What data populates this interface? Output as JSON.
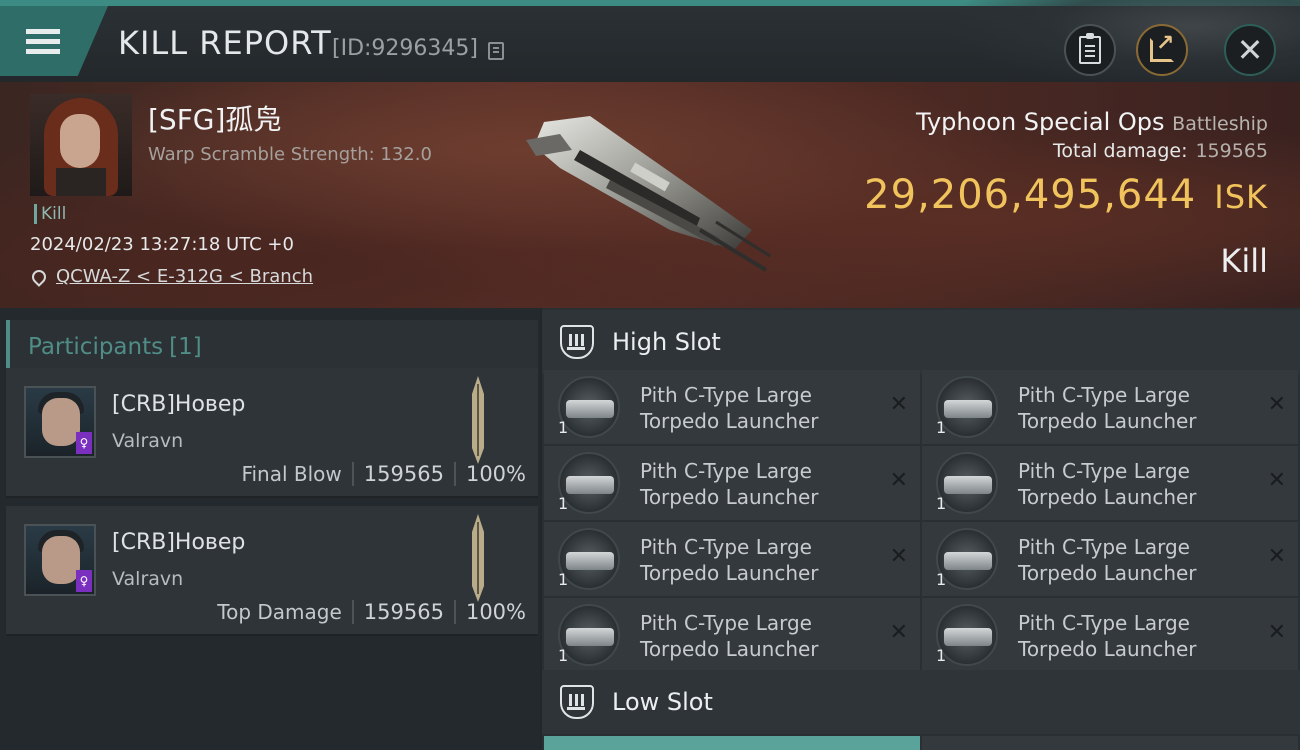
{
  "header": {
    "title": "KILL REPORT",
    "report_id": "[ID:9296345]"
  },
  "victim": {
    "pilot_name": "[SFG]孤凫",
    "warp_scramble": "Warp Scramble Strength: 132.0",
    "tag": "Kill",
    "datetime": "2024/02/23 13:27:18 UTC +0",
    "location": "QCWA-Z < E-312G < Branch",
    "ship_name": "Typhoon Special Ops",
    "ship_class": "Battleship",
    "total_damage_label": "Total damage:",
    "total_damage": "159565",
    "isk_value": "29,206,495,644",
    "isk_unit": "ISK",
    "result": "Kill"
  },
  "participants": {
    "title": "Participants",
    "count": "[1]",
    "rows": [
      {
        "name": "[CRB]Новер",
        "ship": "Valravn",
        "role": "Final Blow",
        "damage": "159565",
        "percent": "100%"
      },
      {
        "name": "[CRB]Новер",
        "ship": "Valravn",
        "role": "Top Damage",
        "damage": "159565",
        "percent": "100%"
      }
    ]
  },
  "slots": {
    "high_title": "High Slot",
    "low_title": "Low Slot",
    "modules": [
      {
        "name": "Pith C-Type Large Torpedo Launcher",
        "qty": "1"
      },
      {
        "name": "Pith C-Type Large Torpedo Launcher",
        "qty": "1"
      },
      {
        "name": "Pith C-Type Large Torpedo Launcher",
        "qty": "1"
      },
      {
        "name": "Pith C-Type Large Torpedo Launcher",
        "qty": "1"
      },
      {
        "name": "Pith C-Type Large Torpedo Launcher",
        "qty": "1"
      },
      {
        "name": "Pith C-Type Large Torpedo Launcher",
        "qty": "1"
      },
      {
        "name": "Pith C-Type Large Torpedo Launcher",
        "qty": "1"
      },
      {
        "name": "Pith C-Type Large Torpedo Launcher",
        "qty": "1"
      }
    ],
    "remove_glyph": "✕"
  },
  "icons": {
    "menu": "menu-icon",
    "copy": "copy-icon",
    "clipboard": "clipboard-icon",
    "share": "share-icon",
    "close": "close-icon",
    "location": "map-pin-icon",
    "slot": "shield-icon"
  },
  "colors": {
    "accent": "#3d8c83",
    "isk": "#f1c35c",
    "participants_title": "#4f8d86"
  }
}
